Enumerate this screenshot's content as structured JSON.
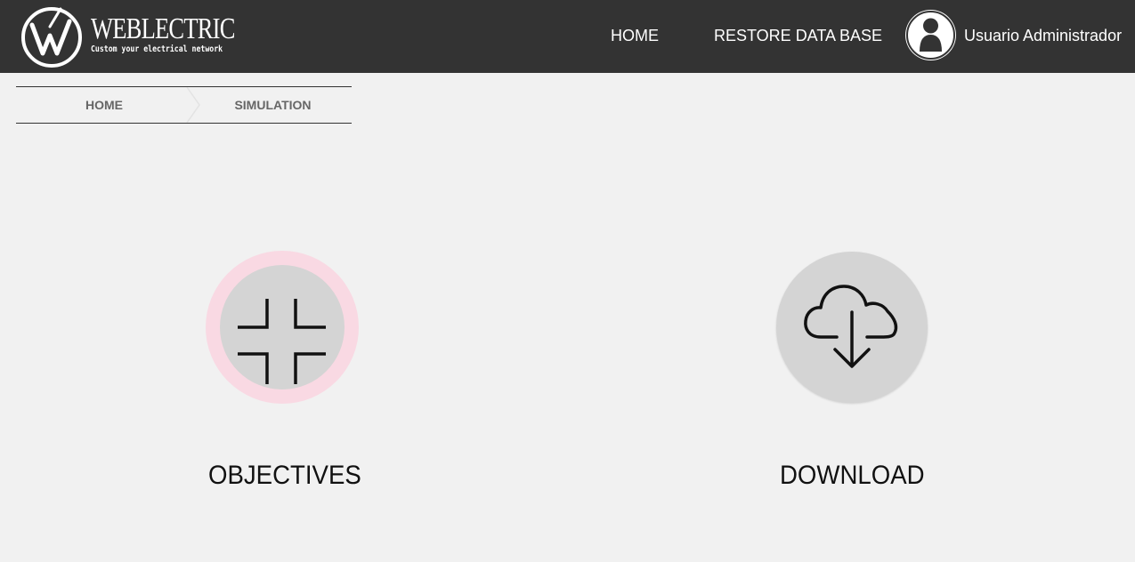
{
  "header": {
    "brand_name": "WEBLECTRIC",
    "brand_tagline": "Custom your electrical network",
    "nav": [
      {
        "label": "HOME"
      },
      {
        "label": "RESTORE DATA BASE"
      }
    ],
    "user": {
      "name": "Usuario Administrador",
      "avatar_icon": "user-icon"
    }
  },
  "breadcrumb": {
    "items": [
      {
        "label": "HOME"
      },
      {
        "label": "SIMULATION"
      }
    ]
  },
  "actions": [
    {
      "label": "OBJECTIVES",
      "icon": "collapse-icon",
      "ring_color": "#f9d9e3"
    },
    {
      "label": "DOWNLOAD",
      "icon": "cloud-download-icon"
    }
  ],
  "colors": {
    "topbar": "#333333",
    "background": "#f1f1f1",
    "circle": "#d4d4d4"
  }
}
